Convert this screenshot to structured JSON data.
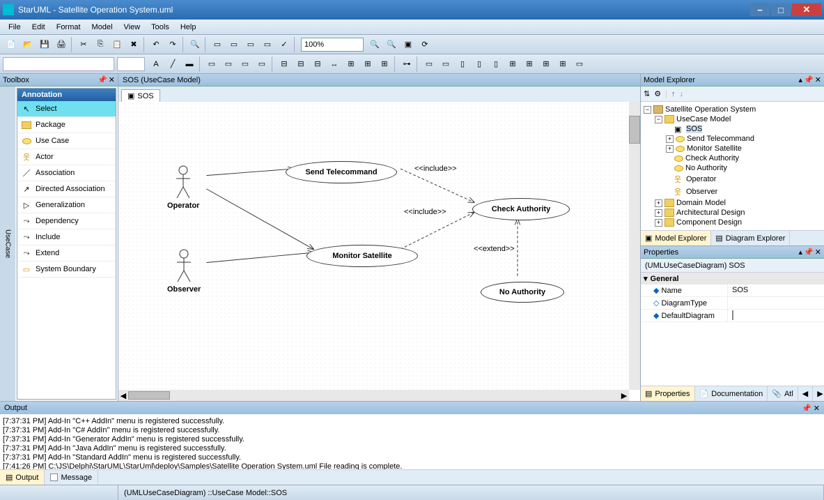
{
  "app": {
    "title": "StarUML - Satellite Operation System.uml"
  },
  "menus": [
    "File",
    "Edit",
    "Format",
    "Model",
    "View",
    "Tools",
    "Help"
  ],
  "zoom": "100%",
  "toolbox": {
    "title": "Toolbox",
    "side_tab": "UseCase",
    "group": "Annotation",
    "items": [
      "Select",
      "Package",
      "Use Case",
      "Actor",
      "Association",
      "Directed Association",
      "Generalization",
      "Dependency",
      "Include",
      "Extend",
      "System Boundary"
    ]
  },
  "diagram": {
    "breadcrumb": "SOS (UseCase Model)",
    "tab": "SOS",
    "actors": {
      "op": "Operator",
      "ob": "Observer"
    },
    "usecases": {
      "send": "Send Telecommand",
      "monitor": "Monitor Satellite",
      "check": "Check Authority",
      "noauth": "No Authority"
    },
    "stereo_include": "<<include>>",
    "stereo_extend": "<<extend>>"
  },
  "explorer": {
    "title": "Model Explorer",
    "root": "Satellite Operation System",
    "usecase_model": "UseCase Model",
    "sos": "SOS",
    "items": [
      "Send Telecommand",
      "Monitor Satellite",
      "Check Authority",
      "No Authority",
      "Operator",
      "Observer"
    ],
    "domain": "Domain Model",
    "arch": "Architectural Design",
    "comp": "Component Design",
    "tab1": "Model Explorer",
    "tab2": "Diagram Explorer"
  },
  "props": {
    "title": "Properties",
    "obj": "(UMLUseCaseDiagram) SOS",
    "cat": "General",
    "rows": {
      "name_k": "Name",
      "name_v": "SOS",
      "dt_k": "DiagramType",
      "dt_v": "",
      "dd_k": "DefaultDiagram"
    },
    "tabs": {
      "p": "Properties",
      "d": "Documentation",
      "a": "Atl"
    }
  },
  "output": {
    "title": "Output",
    "lines": [
      "[7:37:31 PM]  Add-In \"C++ AddIn\" menu is registered successfully.",
      "[7:37:31 PM]  Add-In \"C# AddIn\" menu is registered successfully.",
      "[7:37:31 PM]  Add-In \"Generator AddIn\" menu is registered successfully.",
      "[7:37:31 PM]  Add-In \"Java AddIn\" menu is registered successfully.",
      "[7:37:31 PM]  Add-In \"Standard AddIn\" menu is registered successfully.",
      "[7:41:26 PM]  C:\\JS\\Delphi\\StarUML\\StarUml\\deploy\\Samples\\Satellite Operation System.uml File reading is complete."
    ],
    "tab1": "Output",
    "tab2": "Message"
  },
  "status": "(UMLUseCaseDiagram) ::UseCase Model::SOS"
}
